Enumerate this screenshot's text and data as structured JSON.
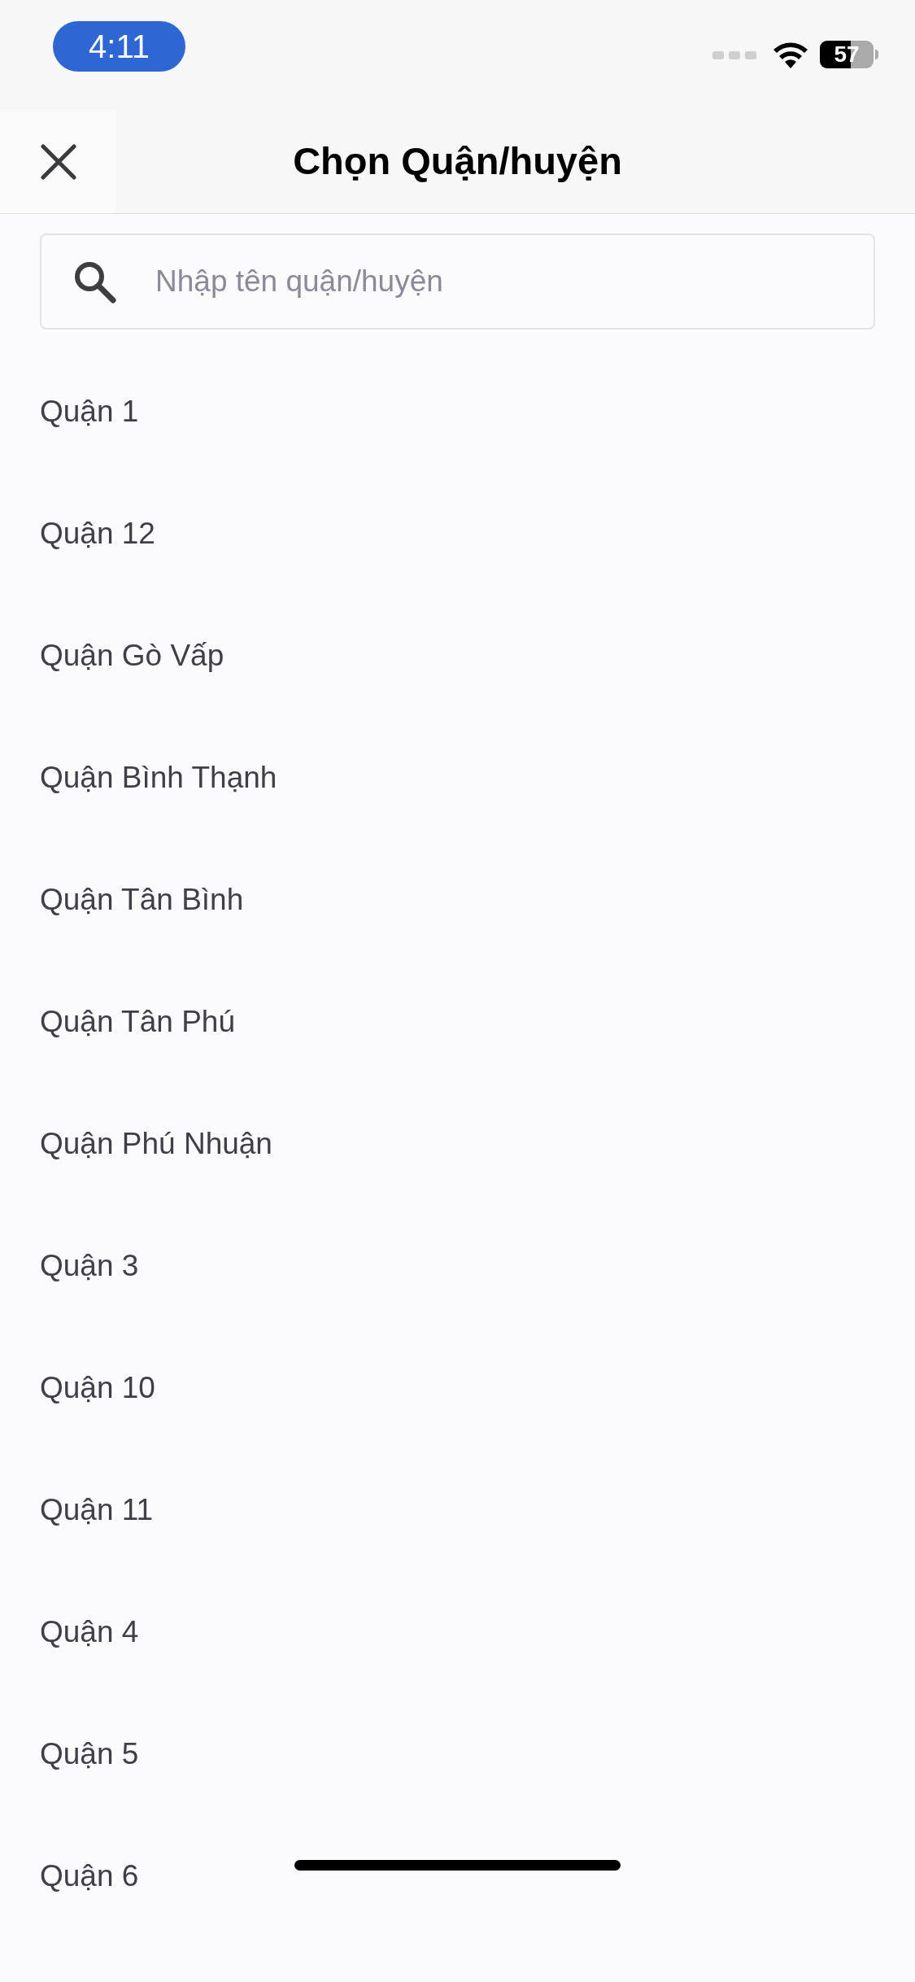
{
  "status_bar": {
    "time": "4:11",
    "battery": "57"
  },
  "header": {
    "title": "Chọn Quận/huyện"
  },
  "search": {
    "placeholder": "Nhập tên quận/huyện"
  },
  "districts": [
    "Quận 1",
    "Quận 12",
    "Quận Gò Vấp",
    "Quận Bình Thạnh",
    "Quận Tân Bình",
    "Quận Tân Phú",
    "Quận Phú Nhuận",
    "Quận 3",
    "Quận 10",
    "Quận 11",
    "Quận 4",
    "Quận 5",
    "Quận 6"
  ]
}
